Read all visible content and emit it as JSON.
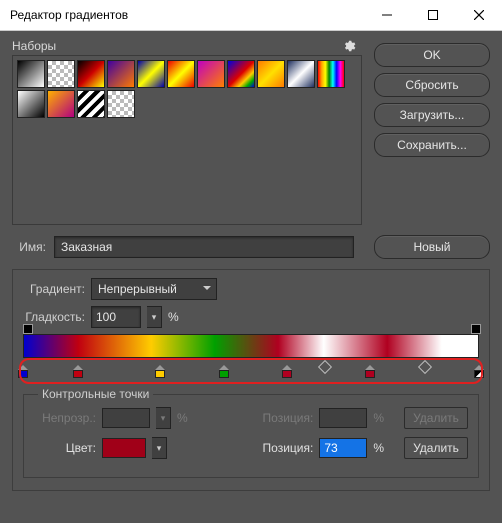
{
  "window": {
    "title": "Редактор градиентов"
  },
  "presets": {
    "label": "Наборы",
    "swatches": [
      {
        "bg": "linear-gradient(135deg,#000 0%,#fff 100%)"
      },
      {
        "bg": "checker"
      },
      {
        "bg": "linear-gradient(135deg,#000 0%,#c00 50%,#ff0 100%)"
      },
      {
        "bg": "linear-gradient(135deg,#4000a0 0%,#ff7a00 100%)"
      },
      {
        "bg": "linear-gradient(135deg,#00a 0%,#ff0 50%,#00a 100%)"
      },
      {
        "bg": "linear-gradient(135deg,#e00 0%,#ff0 50%,#e00 100%)"
      },
      {
        "bg": "linear-gradient(135deg,#c000c0 0%,#ff8000 100%)"
      },
      {
        "bg": "linear-gradient(135deg,#00d 0%,#d00 50%,#fc0 70%,#0a0 85%,#00d 100%)"
      },
      {
        "bg": "linear-gradient(135deg,#ff7a00 0%,#ffe000 50%,#ff7a00 100%)"
      },
      {
        "bg": "linear-gradient(135deg,#203060 0%,#fff 50%,#203060 100%)"
      },
      {
        "bg": "linear-gradient(90deg,red,orange,yellow,green,cyan,blue,magenta,red)"
      },
      {
        "bg": "linear-gradient(135deg,#fff 0%,#000 100%)"
      },
      {
        "bg": "linear-gradient(135deg,#ffb000 0%,#b00080 100%)"
      },
      {
        "bg": "repeating-linear-gradient(135deg,#fff 0 4px,#000 4px 8px)"
      },
      {
        "bg": "checker"
      }
    ]
  },
  "buttons": {
    "ok": "OK",
    "reset": "Сбросить",
    "load": "Загрузить...",
    "save": "Сохранить...",
    "new": "Новый",
    "delete": "Удалить"
  },
  "name": {
    "label": "Имя:",
    "value": "Заказная"
  },
  "gradient": {
    "typeLabel": "Градиент:",
    "typeValue": "Непрерывный",
    "smoothLabel": "Гладкость:",
    "smoothValue": "100",
    "percent": "%"
  },
  "stops": [
    {
      "pos": 0,
      "color": "#0000d0"
    },
    {
      "pos": 12,
      "color": "#c00010"
    },
    {
      "pos": 30,
      "color": "#ffcc00"
    },
    {
      "pos": 44,
      "color": "#00a000"
    },
    {
      "pos": 58,
      "color": "#b00020"
    },
    {
      "pos": 76,
      "color": "#b00020"
    },
    {
      "pos": 100,
      "color": "split"
    }
  ],
  "midpoints": [
    66,
    88
  ],
  "controlPoints": {
    "title": "Контрольные точки",
    "opacityLabel": "Непрозр.:",
    "opacityValue": "",
    "positionLabel": "Позиция:",
    "positionValue": "",
    "colorLabel": "Цвет:",
    "colorValue": "#a00018",
    "position2Value": "73"
  }
}
